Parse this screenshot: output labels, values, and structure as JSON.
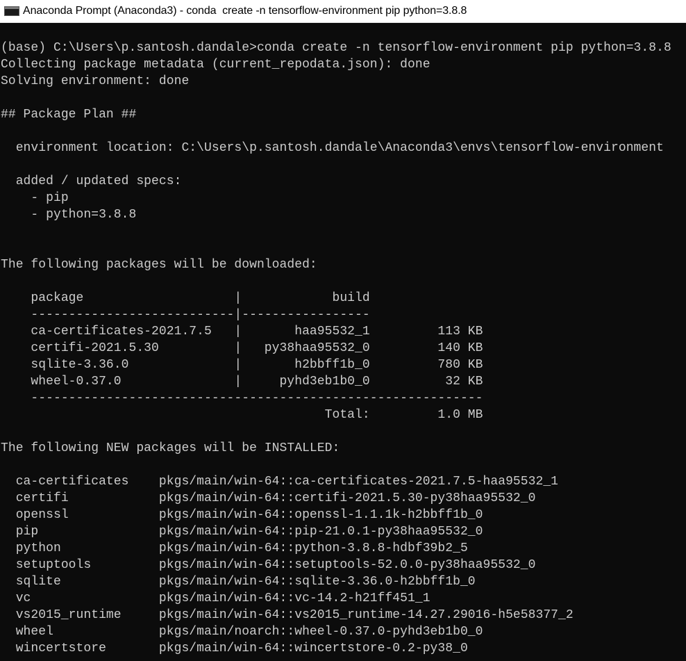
{
  "window": {
    "title": "Anaconda Prompt (Anaconda3) - conda  create -n tensorflow-environment pip python=3.8.8",
    "icon": "console-icon"
  },
  "console": {
    "lines": [
      "(base) C:\\Users\\p.santosh.dandale>conda create -n tensorflow-environment pip python=3.8.8",
      "Collecting package metadata (current_repodata.json): done",
      "Solving environment: done",
      "",
      "## Package Plan ##",
      "",
      "  environment location: C:\\Users\\p.santosh.dandale\\Anaconda3\\envs\\tensorflow-environment",
      "",
      "  added / updated specs:",
      "    - pip",
      "    - python=3.8.8",
      "",
      "",
      "The following packages will be downloaded:",
      "",
      "    package                    |            build",
      "    ---------------------------|-----------------",
      "    ca-certificates-2021.7.5   |       haa95532_1         113 KB",
      "    certifi-2021.5.30          |   py38haa95532_0         140 KB",
      "    sqlite-3.36.0              |       h2bbff1b_0         780 KB",
      "    wheel-0.37.0               |     pyhd3eb1b0_0          32 KB",
      "    ------------------------------------------------------------",
      "                                           Total:         1.0 MB",
      "",
      "The following NEW packages will be INSTALLED:",
      "",
      "  ca-certificates    pkgs/main/win-64::ca-certificates-2021.7.5-haa95532_1",
      "  certifi            pkgs/main/win-64::certifi-2021.5.30-py38haa95532_0",
      "  openssl            pkgs/main/win-64::openssl-1.1.1k-h2bbff1b_0",
      "  pip                pkgs/main/win-64::pip-21.0.1-py38haa95532_0",
      "  python             pkgs/main/win-64::python-3.8.8-hdbf39b2_5",
      "  setuptools         pkgs/main/win-64::setuptools-52.0.0-py38haa95532_0",
      "  sqlite             pkgs/main/win-64::sqlite-3.36.0-h2bbff1b_0",
      "  vc                 pkgs/main/win-64::vc-14.2-h21ff451_1",
      "  vs2015_runtime     pkgs/main/win-64::vs2015_runtime-14.27.29016-h5e58377_2",
      "  wheel              pkgs/main/noarch::wheel-0.37.0-pyhd3eb1b0_0",
      "  wincertstore       pkgs/main/win-64::wincertstore-0.2-py38_0"
    ]
  },
  "colors": {
    "background": "#0c0c0c",
    "text": "#cccccc",
    "titlebar": "#ffffff"
  }
}
